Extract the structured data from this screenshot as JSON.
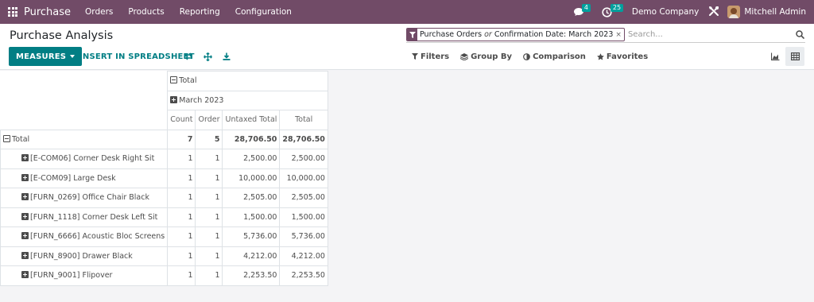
{
  "navbar": {
    "app_name": "Purchase",
    "menu": [
      "Orders",
      "Products",
      "Reporting",
      "Configuration"
    ],
    "messages_count": "4",
    "activities_count": "25",
    "company": "Demo Company",
    "user": "Mitchell Admin"
  },
  "page": {
    "title": "Purchase Analysis"
  },
  "search": {
    "facet_part1": "Purchase Orders",
    "facet_or": "or",
    "facet_part2": "Confirmation Date: March 2023",
    "facet_close": "×",
    "placeholder": "Search..."
  },
  "toolbar": {
    "measures_label": "MEASURES",
    "spreadsheet_label": "INSERT IN SPREADSHEET"
  },
  "search_options": {
    "filters": "Filters",
    "group_by": "Group By",
    "comparison": "Comparison",
    "favorites": "Favorites"
  },
  "pivot": {
    "col_total_label": "Total",
    "col_month_label": "March 2023",
    "measures": [
      "Count",
      "Order",
      "Untaxed Total",
      "Total"
    ],
    "total_row": {
      "label": "Total",
      "count": "7",
      "order": "5",
      "untaxed": "28,706.50",
      "total": "28,706.50"
    },
    "rows": [
      {
        "label": "[E-COM06] Corner Desk Right Sit",
        "count": "1",
        "order": "1",
        "untaxed": "2,500.00",
        "total": "2,500.00"
      },
      {
        "label": "[E-COM09] Large Desk",
        "count": "1",
        "order": "1",
        "untaxed": "10,000.00",
        "total": "10,000.00"
      },
      {
        "label": "[FURN_0269] Office Chair Black",
        "count": "1",
        "order": "1",
        "untaxed": "2,505.00",
        "total": "2,505.00"
      },
      {
        "label": "[FURN_1118] Corner Desk Left Sit",
        "count": "1",
        "order": "1",
        "untaxed": "1,500.00",
        "total": "1,500.00"
      },
      {
        "label": "[FURN_6666] Acoustic Bloc Screens",
        "count": "1",
        "order": "1",
        "untaxed": "5,736.00",
        "total": "5,736.00"
      },
      {
        "label": "[FURN_8900] Drawer Black",
        "count": "1",
        "order": "1",
        "untaxed": "4,212.00",
        "total": "4,212.00"
      },
      {
        "label": "[FURN_9001] Flipover",
        "count": "1",
        "order": "1",
        "untaxed": "2,253.50",
        "total": "2,253.50"
      }
    ]
  },
  "colors": {
    "navbar": "#714b67",
    "primary_button": "#017e84",
    "badge": "#00a09d"
  }
}
